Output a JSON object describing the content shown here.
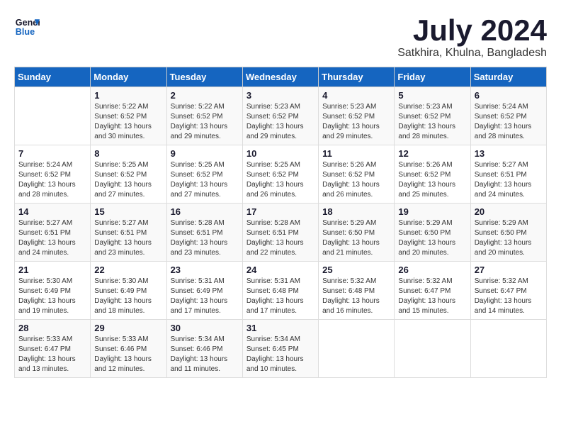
{
  "header": {
    "logo_line1": "General",
    "logo_line2": "Blue",
    "month_year": "July 2024",
    "location": "Satkhira, Khulna, Bangladesh"
  },
  "days_of_week": [
    "Sunday",
    "Monday",
    "Tuesday",
    "Wednesday",
    "Thursday",
    "Friday",
    "Saturday"
  ],
  "weeks": [
    [
      {
        "day": "",
        "info": ""
      },
      {
        "day": "1",
        "info": "Sunrise: 5:22 AM\nSunset: 6:52 PM\nDaylight: 13 hours\nand 30 minutes."
      },
      {
        "day": "2",
        "info": "Sunrise: 5:22 AM\nSunset: 6:52 PM\nDaylight: 13 hours\nand 29 minutes."
      },
      {
        "day": "3",
        "info": "Sunrise: 5:23 AM\nSunset: 6:52 PM\nDaylight: 13 hours\nand 29 minutes."
      },
      {
        "day": "4",
        "info": "Sunrise: 5:23 AM\nSunset: 6:52 PM\nDaylight: 13 hours\nand 29 minutes."
      },
      {
        "day": "5",
        "info": "Sunrise: 5:23 AM\nSunset: 6:52 PM\nDaylight: 13 hours\nand 28 minutes."
      },
      {
        "day": "6",
        "info": "Sunrise: 5:24 AM\nSunset: 6:52 PM\nDaylight: 13 hours\nand 28 minutes."
      }
    ],
    [
      {
        "day": "7",
        "info": "Sunrise: 5:24 AM\nSunset: 6:52 PM\nDaylight: 13 hours\nand 28 minutes."
      },
      {
        "day": "8",
        "info": "Sunrise: 5:25 AM\nSunset: 6:52 PM\nDaylight: 13 hours\nand 27 minutes."
      },
      {
        "day": "9",
        "info": "Sunrise: 5:25 AM\nSunset: 6:52 PM\nDaylight: 13 hours\nand 27 minutes."
      },
      {
        "day": "10",
        "info": "Sunrise: 5:25 AM\nSunset: 6:52 PM\nDaylight: 13 hours\nand 26 minutes."
      },
      {
        "day": "11",
        "info": "Sunrise: 5:26 AM\nSunset: 6:52 PM\nDaylight: 13 hours\nand 26 minutes."
      },
      {
        "day": "12",
        "info": "Sunrise: 5:26 AM\nSunset: 6:52 PM\nDaylight: 13 hours\nand 25 minutes."
      },
      {
        "day": "13",
        "info": "Sunrise: 5:27 AM\nSunset: 6:51 PM\nDaylight: 13 hours\nand 24 minutes."
      }
    ],
    [
      {
        "day": "14",
        "info": "Sunrise: 5:27 AM\nSunset: 6:51 PM\nDaylight: 13 hours\nand 24 minutes."
      },
      {
        "day": "15",
        "info": "Sunrise: 5:27 AM\nSunset: 6:51 PM\nDaylight: 13 hours\nand 23 minutes."
      },
      {
        "day": "16",
        "info": "Sunrise: 5:28 AM\nSunset: 6:51 PM\nDaylight: 13 hours\nand 23 minutes."
      },
      {
        "day": "17",
        "info": "Sunrise: 5:28 AM\nSunset: 6:51 PM\nDaylight: 13 hours\nand 22 minutes."
      },
      {
        "day": "18",
        "info": "Sunrise: 5:29 AM\nSunset: 6:50 PM\nDaylight: 13 hours\nand 21 minutes."
      },
      {
        "day": "19",
        "info": "Sunrise: 5:29 AM\nSunset: 6:50 PM\nDaylight: 13 hours\nand 20 minutes."
      },
      {
        "day": "20",
        "info": "Sunrise: 5:29 AM\nSunset: 6:50 PM\nDaylight: 13 hours\nand 20 minutes."
      }
    ],
    [
      {
        "day": "21",
        "info": "Sunrise: 5:30 AM\nSunset: 6:49 PM\nDaylight: 13 hours\nand 19 minutes."
      },
      {
        "day": "22",
        "info": "Sunrise: 5:30 AM\nSunset: 6:49 PM\nDaylight: 13 hours\nand 18 minutes."
      },
      {
        "day": "23",
        "info": "Sunrise: 5:31 AM\nSunset: 6:49 PM\nDaylight: 13 hours\nand 17 minutes."
      },
      {
        "day": "24",
        "info": "Sunrise: 5:31 AM\nSunset: 6:48 PM\nDaylight: 13 hours\nand 17 minutes."
      },
      {
        "day": "25",
        "info": "Sunrise: 5:32 AM\nSunset: 6:48 PM\nDaylight: 13 hours\nand 16 minutes."
      },
      {
        "day": "26",
        "info": "Sunrise: 5:32 AM\nSunset: 6:47 PM\nDaylight: 13 hours\nand 15 minutes."
      },
      {
        "day": "27",
        "info": "Sunrise: 5:32 AM\nSunset: 6:47 PM\nDaylight: 13 hours\nand 14 minutes."
      }
    ],
    [
      {
        "day": "28",
        "info": "Sunrise: 5:33 AM\nSunset: 6:47 PM\nDaylight: 13 hours\nand 13 minutes."
      },
      {
        "day": "29",
        "info": "Sunrise: 5:33 AM\nSunset: 6:46 PM\nDaylight: 13 hours\nand 12 minutes."
      },
      {
        "day": "30",
        "info": "Sunrise: 5:34 AM\nSunset: 6:46 PM\nDaylight: 13 hours\nand 11 minutes."
      },
      {
        "day": "31",
        "info": "Sunrise: 5:34 AM\nSunset: 6:45 PM\nDaylight: 13 hours\nand 10 minutes."
      },
      {
        "day": "",
        "info": ""
      },
      {
        "day": "",
        "info": ""
      },
      {
        "day": "",
        "info": ""
      }
    ]
  ]
}
